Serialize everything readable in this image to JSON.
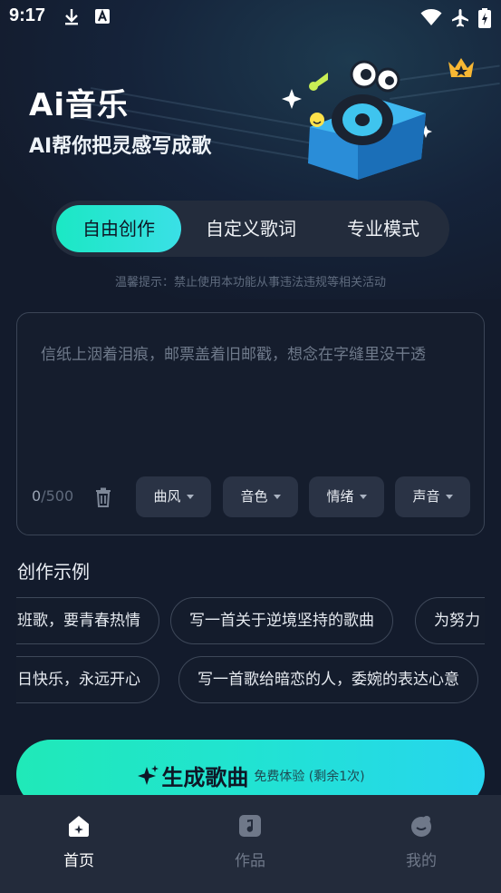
{
  "status_bar": {
    "time": "9:17"
  },
  "header": {
    "title": "Ai音乐",
    "subtitle": "AI帮你把灵感写成歌"
  },
  "tabs": [
    {
      "label": "自由创作",
      "active": true
    },
    {
      "label": "自定义歌词",
      "active": false
    },
    {
      "label": "专业模式",
      "active": false
    }
  ],
  "notice": "温馨提示：禁止使用本功能从事违法违规等相关活动",
  "input": {
    "placeholder": "信纸上洇着泪痕，邮票盖着旧邮戳，想念在字缝里没干透",
    "count_current": "0",
    "count_max": "/500"
  },
  "options": [
    {
      "label": "曲风"
    },
    {
      "label": "音色"
    },
    {
      "label": "情绪"
    },
    {
      "label": "声音"
    }
  ],
  "examples": {
    "title": "创作示例",
    "row1": [
      "班歌，要青春热情",
      "写一首关于逆境坚持的歌曲",
      "为努力"
    ],
    "row2": [
      "日快乐，永远开心",
      "写一首歌给暗恋的人，委婉的表达心意"
    ]
  },
  "generate": {
    "label": "生成歌曲",
    "sub": "免费体验 (剩余1次)"
  },
  "nav": [
    {
      "label": "首页",
      "icon": "home-icon",
      "active": true
    },
    {
      "label": "作品",
      "icon": "music-note-icon",
      "active": false
    },
    {
      "label": "我的",
      "icon": "profile-icon",
      "active": false
    }
  ],
  "colors": {
    "accent_start": "#1be8c4",
    "accent_end": "#27d5ee",
    "background": "#131b2c"
  }
}
